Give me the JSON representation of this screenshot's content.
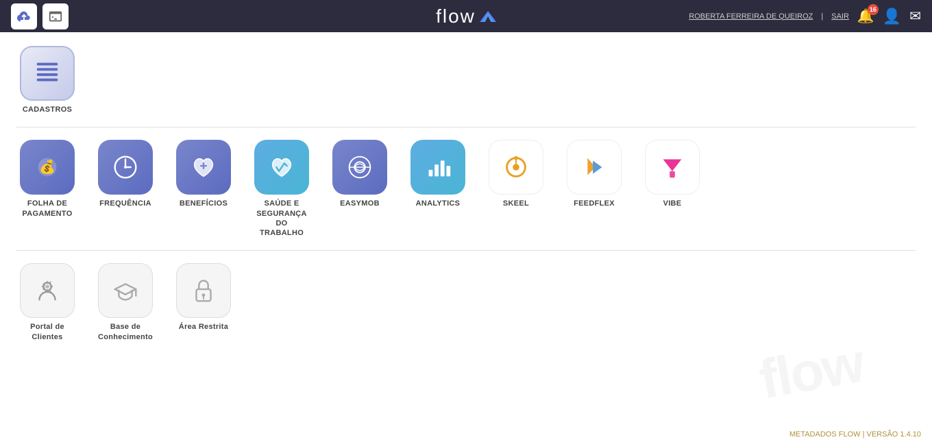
{
  "header": {
    "logo_text": "flow",
    "user_name": "ROBERTA FERREIRA DE QUEIROZ",
    "separator": "|",
    "sair_label": "SAIR",
    "bell_count": "16"
  },
  "sections": {
    "section1": {
      "items": [
        {
          "id": "cadastros",
          "label": "CADASTROS",
          "icon_type": "cadastros"
        }
      ]
    },
    "section2": {
      "items": [
        {
          "id": "folha",
          "label": "FOLHA DE\nPAGAMENTO",
          "label1": "FOLHA DE",
          "label2": "PAGAMENTO",
          "icon_type": "folha"
        },
        {
          "id": "frequencia",
          "label": "FREQUÊNCIA",
          "icon_type": "frequencia"
        },
        {
          "id": "beneficios",
          "label": "BENEFÍCIOS",
          "icon_type": "beneficios"
        },
        {
          "id": "saude",
          "label": "SAÚDE E\nSEGURANÇA DO\nTRABALHO",
          "label1": "SAÚDE E",
          "label2": "SEGURANÇA DO",
          "label3": "TRABALHO",
          "icon_type": "saude"
        },
        {
          "id": "easymob",
          "label": "EASYMOB",
          "icon_type": "easymob"
        },
        {
          "id": "analytics",
          "label": "ANALYTICS",
          "icon_type": "analytics"
        },
        {
          "id": "skeel",
          "label": "SKEEL",
          "icon_type": "skeel"
        },
        {
          "id": "feedflex",
          "label": "FEEDFLEX",
          "icon_type": "feedflex"
        },
        {
          "id": "vibe",
          "label": "VIBE",
          "icon_type": "vibe"
        }
      ]
    },
    "section3": {
      "items": [
        {
          "id": "portal",
          "label": "Portal de Clientes",
          "icon_type": "portal"
        },
        {
          "id": "base",
          "label": "Base de\nConhecimento",
          "label1": "Base de",
          "label2": "Conhecimento",
          "icon_type": "base"
        },
        {
          "id": "restrita",
          "label": "Área Restrita",
          "icon_type": "restrita"
        }
      ]
    }
  },
  "footer": {
    "text": "METADADOS FLOW | VERSÃO 1.4.10"
  }
}
